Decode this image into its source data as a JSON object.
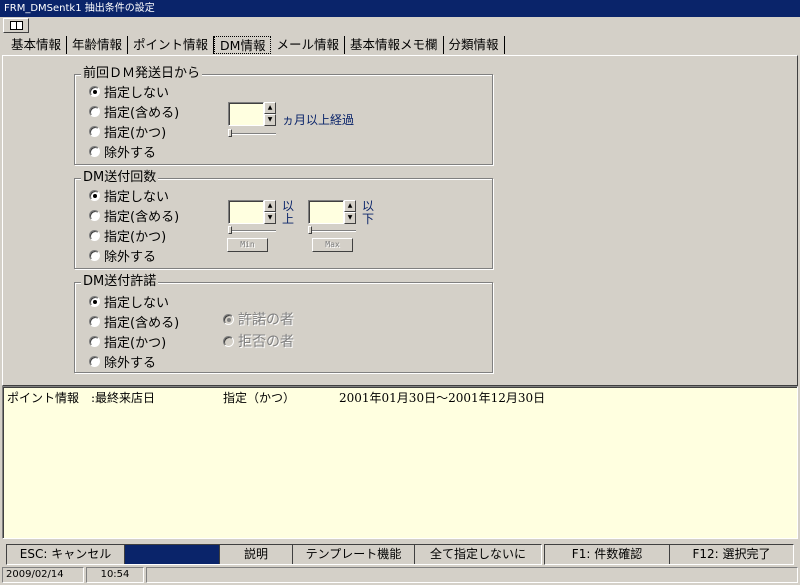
{
  "window": {
    "title": "FRM_DMSentk1 抽出条件の設定"
  },
  "tabs": [
    "基本情報",
    "年齢情報",
    "ポイント情報",
    "DM情報",
    "メール情報",
    "基本情報メモ欄",
    "分類情報"
  ],
  "active_tab": "DM情報",
  "group1": {
    "title": "前回ＤＭ発送日から",
    "options": [
      "指定しない",
      "指定(含める)",
      "指定(かつ)",
      "除外する"
    ],
    "selected": 0,
    "spin_suffix": "ヵ月以上経過"
  },
  "group2": {
    "title": "DM送付回数",
    "options": [
      "指定しない",
      "指定(含める)",
      "指定(かつ)",
      "除外する"
    ],
    "selected": 0,
    "spin1_label_a": "以",
    "spin1_label_b": "上",
    "spin2_label_a": "以",
    "spin2_label_b": "下",
    "min_label": "Min",
    "max_label": "Max"
  },
  "group3": {
    "title": "DM送付許諾",
    "options": [
      "指定しない",
      "指定(含める)",
      "指定(かつ)",
      "除外する"
    ],
    "selected": 0,
    "sub_options": [
      "許諾の者",
      "拒否の者"
    ],
    "sub_selected": 0
  },
  "log": {
    "category": "ポイント情報",
    "field": ":最終来店日",
    "mode": "指定（かつ）",
    "range": "2001年01月30日～2001年12月30日"
  },
  "function_bar": {
    "esc": "ESC: キャンセル",
    "help": "説明",
    "template": "テンプレート機能",
    "clear_all": "全て指定しないに",
    "f1": "F1: 件数確認",
    "f12": "F12: 選択完了"
  },
  "status": {
    "date": "2009/02/14",
    "time": "10:54"
  }
}
